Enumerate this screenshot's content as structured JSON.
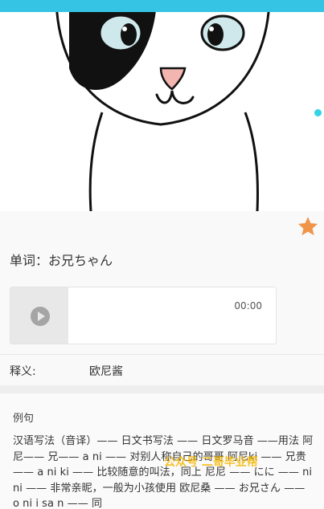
{
  "colors": {
    "topbar": "#35c4e3",
    "indicator": "#35d3e5",
    "star": "#f0944a",
    "watermark": "#f5b800"
  },
  "icons": {
    "favorite": "star-icon",
    "play": "play-icon"
  },
  "word": {
    "label": "单词：",
    "value": "お兄ちゃん"
  },
  "player": {
    "time": "00:00"
  },
  "meaning": {
    "label": "释义:",
    "value": "欧尼酱"
  },
  "examples": {
    "title": "例句",
    "text": "汉语写法（音译）—— 日文书写法 —— 日文罗马音 ——用法 阿尼—— 兄—— a ni —— 对别人称自己的哥哥 阿尼ki —— 兄贵 —— a ni ki —— 比较随意的叫法，同上 尼尼 —— にに —— ni ni —— 非常亲昵，一般为小孩使用 欧尼桑 —— お兄さん —— o ni i sa n —— 同"
  },
  "watermark": "公众号 二哥毕业帮"
}
